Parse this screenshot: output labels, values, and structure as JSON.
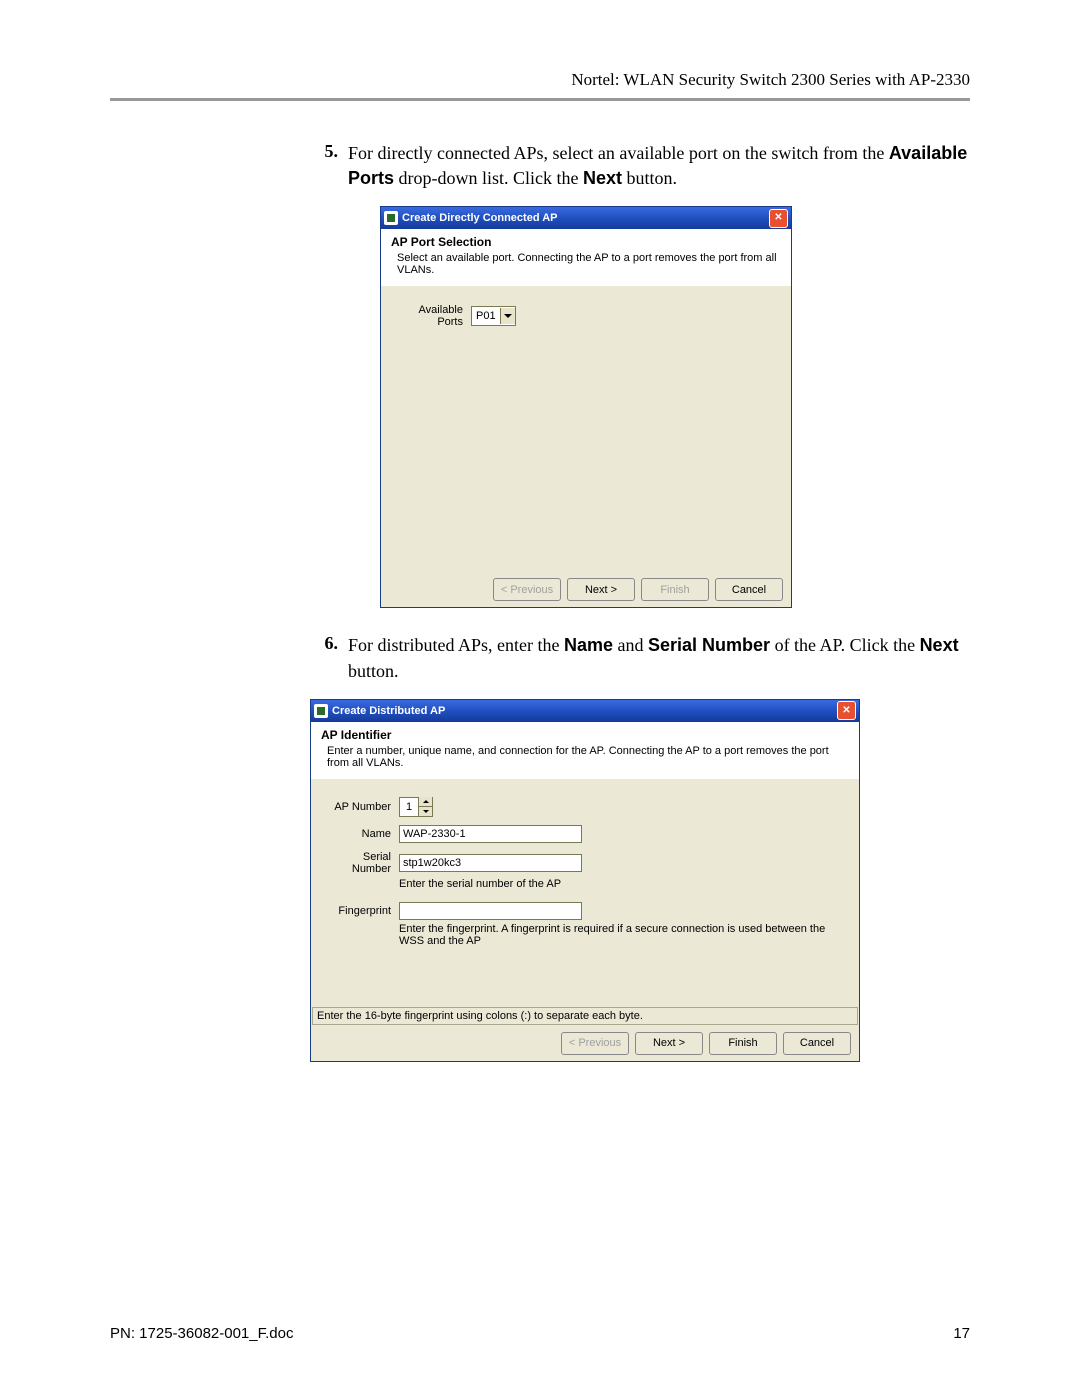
{
  "header": "Nortel: WLAN Security Switch 2300 Series with AP-2330",
  "step5": {
    "num": "5.",
    "text_before": "For directly connected APs, select an available port on the switch from the ",
    "bold1": "Available Ports",
    "text_mid": " drop-down list. Click the ",
    "bold2": "Next",
    "text_after": " button."
  },
  "dialog1": {
    "title": "Create Directly Connected AP",
    "heading": "AP Port Selection",
    "desc": "Select an available port.  Connecting the AP to a port removes the port from all VLANs.",
    "ports_label": "Available Ports",
    "ports_value": "P01",
    "buttons": {
      "prev": "< Previous",
      "next": "Next >",
      "finish": "Finish",
      "cancel": "Cancel"
    }
  },
  "step6": {
    "num": "6.",
    "text_before": "For distributed APs, enter the ",
    "bold1": "Name",
    "text_mid1": " and ",
    "bold2": "Serial Number",
    "text_mid2": " of the AP. Click the ",
    "bold3": "Next",
    "text_after": " button."
  },
  "dialog2": {
    "title": "Create Distributed AP",
    "heading": "AP Identifier",
    "desc": "Enter a number, unique name, and connection for the AP.  Connecting the AP to a port removes the port from all VLANs.",
    "apnum_label": "AP Number",
    "apnum_value": "1",
    "name_label": "Name",
    "name_value": "WAP-2330-1",
    "serial_label": "Serial Number",
    "serial_value": "stp1w20kc3",
    "serial_help": "Enter the serial number of the AP",
    "finger_label": "Fingerprint",
    "finger_value": "",
    "finger_help": "Enter the fingerprint. A fingerprint is required if a secure connection is used between the WSS and the AP",
    "status": "Enter the 16-byte fingerprint using colons (:) to separate each byte.",
    "buttons": {
      "prev": "< Previous",
      "next": "Next >",
      "finish": "Finish",
      "cancel": "Cancel"
    }
  },
  "footer": {
    "left": "PN: 1725-36082-001_F.doc",
    "right": "17"
  }
}
